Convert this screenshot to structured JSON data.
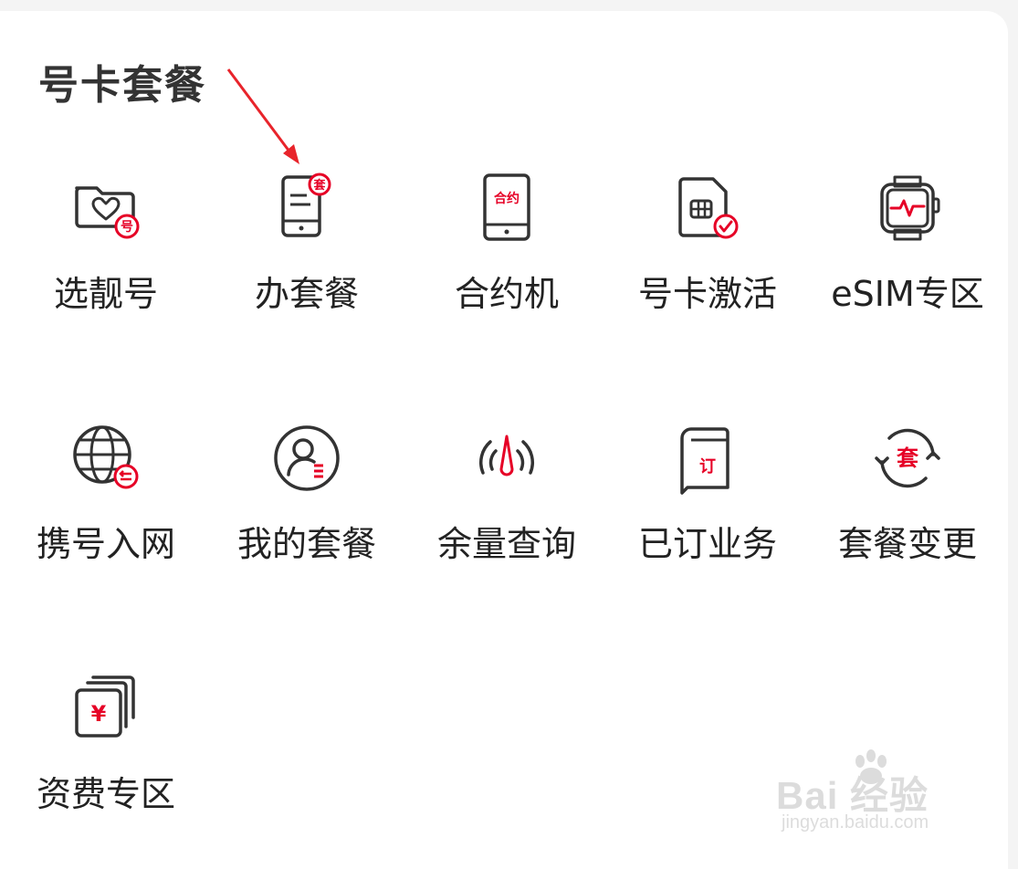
{
  "section": {
    "title": "号卡套餐"
  },
  "grid": {
    "items": [
      {
        "label": "选靓号",
        "icon": "folder-heart-icon",
        "badge": "号"
      },
      {
        "label": "办套餐",
        "icon": "phone-plan-icon",
        "badge": "套"
      },
      {
        "label": "合约机",
        "icon": "contract-phone-icon",
        "badge": "合约"
      },
      {
        "label": "号卡激活",
        "icon": "sim-activate-icon"
      },
      {
        "label": "eSIM专区",
        "icon": "smartwatch-icon"
      },
      {
        "label": "携号入网",
        "icon": "globe-transfer-icon"
      },
      {
        "label": "我的套餐",
        "icon": "user-plan-icon"
      },
      {
        "label": "余量查询",
        "icon": "signal-gauge-icon"
      },
      {
        "label": "已订业务",
        "icon": "ordered-doc-icon",
        "badge": "订"
      },
      {
        "label": "套餐变更",
        "icon": "plan-change-icon",
        "badge": "套"
      },
      {
        "label": "资费专区",
        "icon": "tariff-cards-icon",
        "badge": "¥"
      }
    ]
  },
  "watermark": {
    "main": "Bai  经验",
    "sub": "jingyan.baidu.com"
  },
  "colors": {
    "accent": "#e60026",
    "icon_stroke": "#333333",
    "text": "#222222"
  }
}
